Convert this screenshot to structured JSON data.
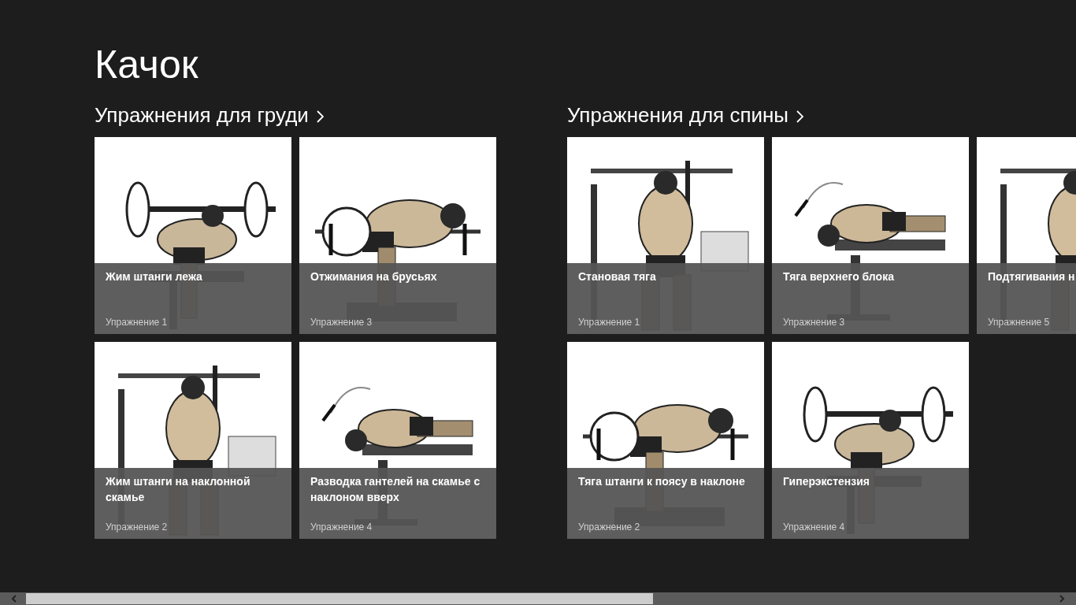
{
  "app_title": "Качок",
  "sections": [
    {
      "title": "Упражнения для груди",
      "tiles": [
        {
          "title": "Жим штанги лежа",
          "caption": "Упражнение 1"
        },
        {
          "title": "Жим штанги на наклонной скамье",
          "caption": "Упражнение 2"
        },
        {
          "title": "Отжимания на брусьях",
          "caption": "Упражнение 3"
        },
        {
          "title": "Разводка гантелей на скамье с наклоном вверх",
          "caption": "Упражнение 4"
        }
      ]
    },
    {
      "title": "Упражнения для спины",
      "tiles": [
        {
          "title": "Становая тяга",
          "caption": "Упражнение 1"
        },
        {
          "title": "Тяга штанги к поясу в наклоне",
          "caption": "Упражнение 2"
        },
        {
          "title": "Тяга верхнего блока",
          "caption": "Упражнение 3"
        },
        {
          "title": "Гиперэкстензия",
          "caption": "Упражнение 4"
        },
        {
          "title": "Подтягивания н",
          "caption": "Упражнение 5"
        }
      ]
    }
  ]
}
